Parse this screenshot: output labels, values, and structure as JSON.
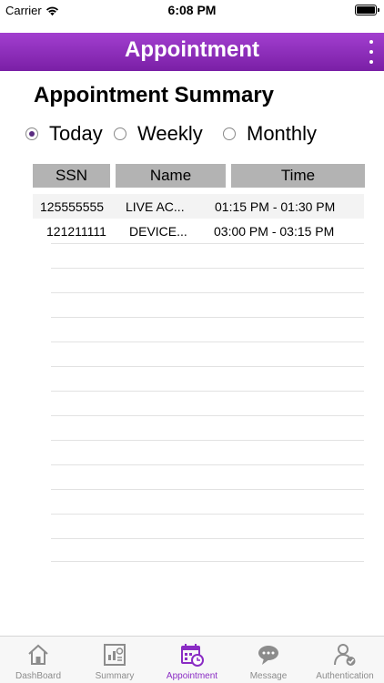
{
  "status_bar": {
    "carrier": "Carrier",
    "time": "6:08 PM"
  },
  "header": {
    "title": "Appointment",
    "menu_icon": "more-vertical-icon"
  },
  "summary": {
    "title": "Appointment Summary"
  },
  "range_options": [
    {
      "label": "Today",
      "selected": true
    },
    {
      "label": "Weekly",
      "selected": false
    },
    {
      "label": "Monthly",
      "selected": false
    }
  ],
  "table": {
    "headers": [
      "SSN",
      "Name",
      "Time"
    ],
    "rows": [
      {
        "ssn": "125555555",
        "name": "LIVE  AC...",
        "time": "01:15  PM - 01:30  PM"
      },
      {
        "ssn": "121211111",
        "name": "DEVICE...",
        "time": "03:00  PM - 03:15  PM"
      }
    ]
  },
  "tabs": [
    {
      "label": "DashBoard",
      "icon": "home-icon"
    },
    {
      "label": "Summary",
      "icon": "report-icon"
    },
    {
      "label": "Appointment",
      "icon": "calendar-clock-icon",
      "active": true
    },
    {
      "label": "Message",
      "icon": "chat-bubble-icon"
    },
    {
      "label": "Authentication",
      "icon": "user-check-icon"
    }
  ],
  "colors": {
    "header": "#8a2cc4",
    "active_tab": "#8a2cc4",
    "table_header": "#b3b3b3"
  }
}
